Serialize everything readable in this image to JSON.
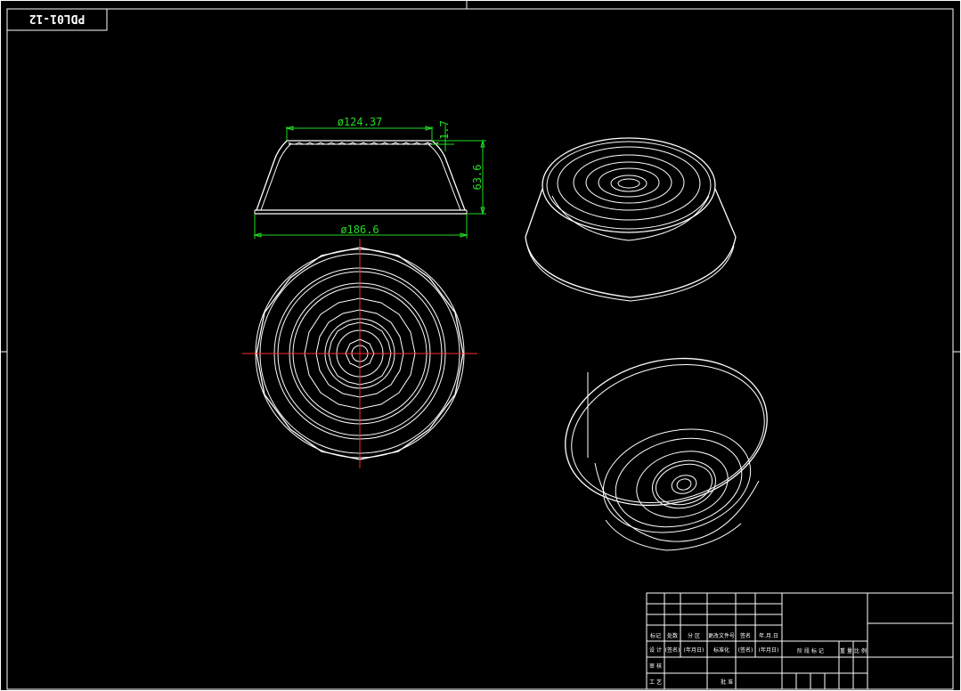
{
  "drawing": {
    "code": "PDL01-12"
  },
  "dimensions": {
    "top_diameter": "ø124.37",
    "rim_thickness": "1.7",
    "height": "63.6",
    "bottom_diameter": "ø186.6"
  },
  "title_block": {
    "row_labels": [
      "标记",
      "处数",
      "分 区",
      "更改文件号",
      "签名",
      "年.月.日"
    ],
    "design_row": [
      "设 计",
      "(签名)",
      "(年月日)",
      "标准化",
      "(签名)",
      "(年月日)"
    ],
    "stage_labels": [
      "阶 段 标 记",
      "重 量",
      "比 例"
    ],
    "check": "审 核",
    "process": "工 艺",
    "approve": "批 准"
  },
  "colors": {
    "background": "#000000",
    "lines": "#ffffff",
    "dimensions": "#22dd22",
    "centerlines": "#ff2a2a"
  }
}
